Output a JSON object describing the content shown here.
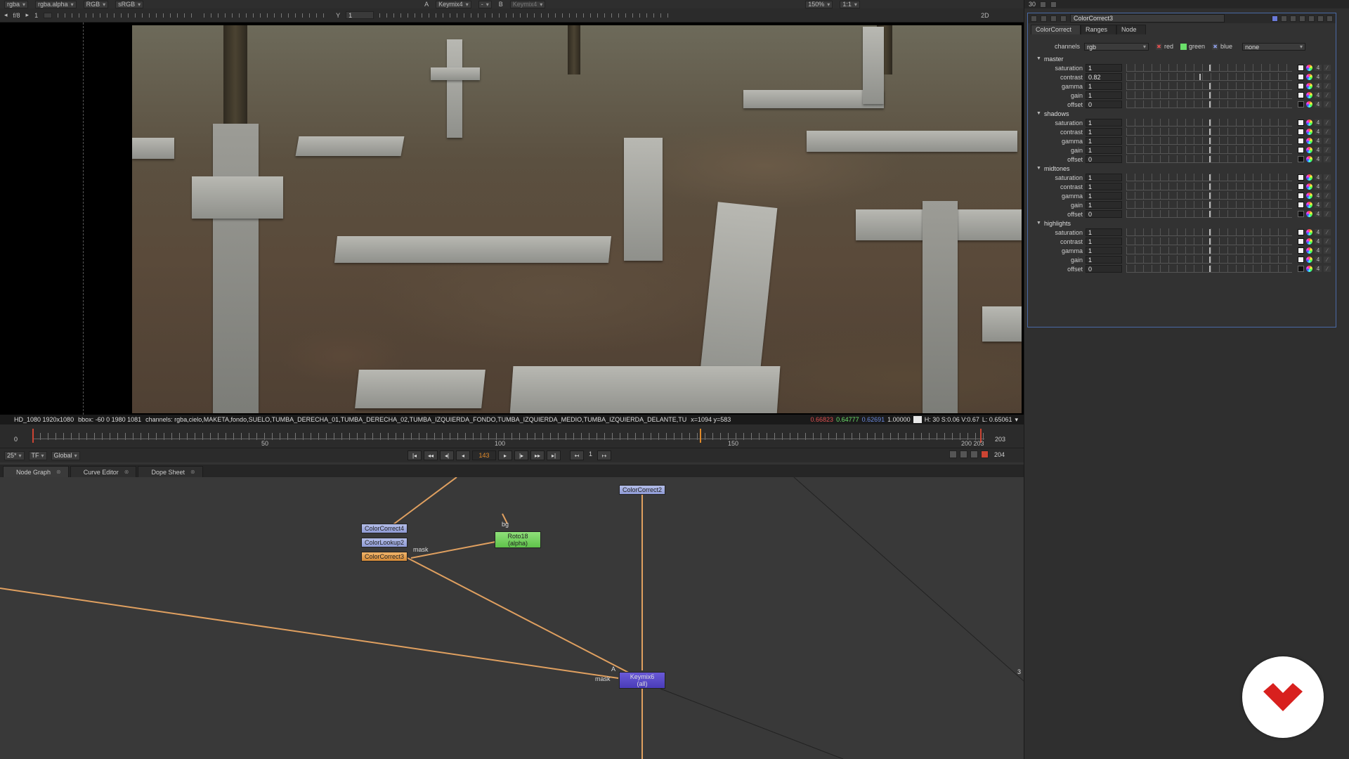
{
  "viewer": {
    "toolbar": {
      "channel_set": "rgba",
      "alpha_channel": "rgba.alpha",
      "display_channel": "RGB",
      "colorspace": "sRGB",
      "input_a_label": "A",
      "input_a": "Keymix4",
      "input_a_op": "-",
      "input_b_label": "B",
      "input_b": "Keymix4",
      "zoom": "150%",
      "ratio": "1:1",
      "view_mode": "2D"
    },
    "toolbar2": {
      "frame_step": "f/8",
      "frame_increment": "1",
      "y_label": "Y",
      "y_value": "1"
    },
    "info_bar": {
      "format": "HD_1080 1920x1080",
      "bbox": "bbox: -60 0 1980 1081",
      "channels": "channels: rgba,cielo,MAKETA,fondo,SUELO,TUMBA_DERECHA_01,TUMBA_DERECHA_02,TUMBA_IZQUIERDA_FONDO,TUMBA_IZQUIERDA_MEDIO,TUMBA_IZQUIERDA_DELANTE,TU",
      "coords": "x=1094 y=583",
      "r": "0.66823",
      "g": "0.64777",
      "b": "0.62691",
      "a": "1.00000",
      "hsv": "H: 30 S:0.06 V:0.67",
      "luminance": "L: 0.65061",
      "colors": {
        "r": "#e05050",
        "g": "#6ae06a",
        "b": "#6a8ae0",
        "a": "#e0e0e0"
      }
    }
  },
  "timeline": {
    "start": "0",
    "end_top": "203",
    "end_bottom": "204",
    "labels": [
      "50",
      "100",
      "150",
      "200 203"
    ],
    "range": [
      0,
      203
    ],
    "current_frame": "143",
    "fps": "25*",
    "tf": "TF",
    "scope": "Global",
    "step": "1"
  },
  "tabs": [
    {
      "label": "Node Graph",
      "active": true
    },
    {
      "label": "Curve Editor",
      "active": false
    },
    {
      "label": "Dope Sheet",
      "active": false
    }
  ],
  "graph": {
    "nodes": {
      "cc4": "ColorCorrect4",
      "clu2": "ColorLookup2",
      "cc3": "ColorCorrect3",
      "cc2": "ColorCorrect2",
      "roto_name": "Roto18",
      "roto_sub": "(alpha)",
      "keymix_name": "Keymix6",
      "keymix_sub": "(all)"
    },
    "labels": {
      "mask1": "mask",
      "mask2": "mask",
      "bg": "bg",
      "a": "A",
      "edge": "3"
    }
  },
  "properties": {
    "node_name": "ColorCorrect3",
    "tabs": [
      "ColorCorrect",
      "Ranges",
      "Node"
    ],
    "channels_label": "channels",
    "channels_value": "rgb",
    "channel_toggles": [
      "red",
      "green",
      "blue"
    ],
    "mask_value": "none",
    "groups": [
      {
        "name": "master",
        "rows": [
          {
            "label": "saturation",
            "value": "1"
          },
          {
            "label": "contrast",
            "value": "0.82"
          },
          {
            "label": "gamma",
            "value": "1"
          },
          {
            "label": "gain",
            "value": "1"
          },
          {
            "label": "offset",
            "value": "0"
          }
        ]
      },
      {
        "name": "shadows",
        "rows": [
          {
            "label": "saturation",
            "value": "1"
          },
          {
            "label": "contrast",
            "value": "1"
          },
          {
            "label": "gamma",
            "value": "1"
          },
          {
            "label": "gain",
            "value": "1"
          },
          {
            "label": "offset",
            "value": "0"
          }
        ]
      },
      {
        "name": "midtones",
        "rows": [
          {
            "label": "saturation",
            "value": "1"
          },
          {
            "label": "contrast",
            "value": "1"
          },
          {
            "label": "gamma",
            "value": "1"
          },
          {
            "label": "gain",
            "value": "1"
          },
          {
            "label": "offset",
            "value": "0"
          }
        ]
      },
      {
        "name": "highlights",
        "rows": [
          {
            "label": "saturation",
            "value": "1"
          },
          {
            "label": "contrast",
            "value": "1"
          },
          {
            "label": "gamma",
            "value": "1"
          },
          {
            "label": "gain",
            "value": "1"
          },
          {
            "label": "offset",
            "value": "0"
          }
        ]
      }
    ],
    "button_four": "4"
  },
  "top_right": {
    "count": "30"
  },
  "colors": {
    "accent": "#e08a2a",
    "panel_border": "#4a6aa6",
    "logo_red": "#d8201e"
  }
}
